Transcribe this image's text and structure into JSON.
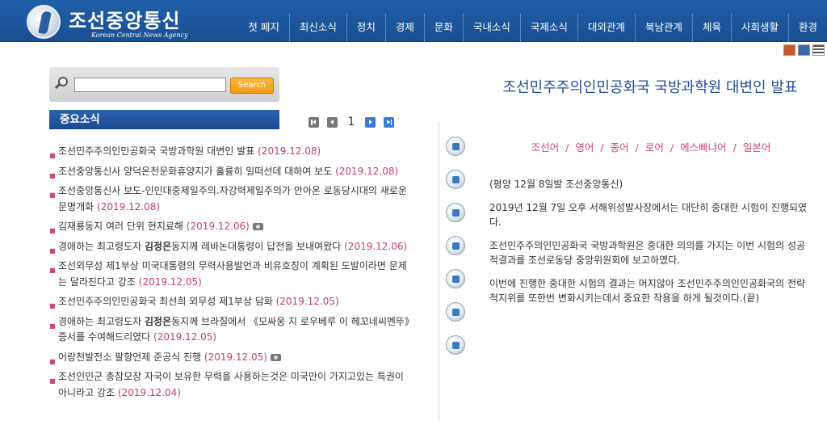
{
  "header": {
    "logo_title": "조선중앙통신",
    "logo_subtitle": "Korean Central News Agency",
    "nav": [
      "첫 페지",
      "최신소식",
      "정치",
      "경제",
      "문화",
      "국내소식",
      "국제소식",
      "대외관계",
      "북남관계",
      "체육",
      "사회생활",
      "환경"
    ]
  },
  "search": {
    "value": "",
    "button_label": "Search"
  },
  "news": {
    "title": "중요소식",
    "current_page": "1",
    "items": [
      {
        "text": "조선민주주의인민공화국 국방과학원 대변인 발표",
        "date": "(2019.12.08)",
        "photo": false
      },
      {
        "text": "조선중앙통신사 양덕온천문화휴양지가 훌륭히 일떠선데 대하여 보도",
        "date": "(2019.12.08)",
        "photo": false
      },
      {
        "text": "조선중앙통신사 보도-인민대중제일주의.자강력제일주의가 안아온 로동당시대의 새로운 문명개화",
        "date": "(2019.12.08)",
        "photo": false
      },
      {
        "text": "김재룡동지 여러 단위 현지료해",
        "date": "(2019.12.06)",
        "photo": true
      },
      {
        "text_pre": "경애하는 최고령도자 ",
        "text_bold": "김정은",
        "text_post": "동지께 레바논대통령이 답전을 보내여왔다",
        "date": "(2019.12.06)",
        "photo": false
      },
      {
        "text": "조선외무성 제1부상 미국대통령의 무력사용발언과 비유호칭이 계획된 도발이라면 문제는 달라진다고 강조",
        "date": "(2019.12.05)",
        "photo": false
      },
      {
        "text": "조선민주주의인민공화국 최선희 외무성 제1부상 담화",
        "date": "(2019.12.05)",
        "photo": false
      },
      {
        "text_pre": "경애하는 최고령도자 ",
        "text_bold": "김정은",
        "text_post": "동지께 브라질에서 《모싸웅 지 로우베루 이 헤꼬네씨멘뚜》증서를 수여해드리였다",
        "date": "(2019.12.05)",
        "photo": false
      },
      {
        "text": "어랑천발전소 팔향언제 준공식 진행",
        "date": "(2019.12.05)",
        "photo": true
      },
      {
        "text": "조선인민군 총참모장 자국이 보유한 무력을 사용하는것은 미국만이 가지고있는 특권이 아니라고 강조",
        "date": "(2019.12.04)",
        "photo": false
      }
    ]
  },
  "article": {
    "title": "조선민주주의인민공화국 국방과학원 대변인 발표",
    "languages": [
      "조선어",
      "영어",
      "중어",
      "로어",
      "에스빠냐어",
      "일본어"
    ],
    "separator": "/",
    "paragraphs": [
      "(평양 12월 8일발 조선중앙통신)",
      "2019년 12월 7일 오후 서해위성발사장에서는 대단히 중대한 시험이 진행되였다.",
      "조선민주주의인민공화국 국방과학원은 중대한 의의를 가지는 이번 시험의 성공적결과를 조선로동당 중앙위원회에 보고하였다.",
      "이번에 진행한 중대한 시험의 결과는 머지않아 조선민주주의인민공화국의 전략적지위를 또한번 변화시키는데서 중요한 작용을 하게 될것이다.(끝)"
    ]
  },
  "colors": {
    "header_blue": "#1f5fa8",
    "title_blue": "#1f4e96",
    "accent_pink": "#d2457e",
    "search_orange": "#f39a12"
  },
  "icons": {
    "utility": [
      "photo-icon",
      "video-icon",
      "menu-icon"
    ],
    "sidebar": [
      "photo-gallery-icon",
      "video-gallery-icon",
      "camera-icon",
      "audio-icon",
      "hotline-icon",
      "person-icon",
      "speaker-icon"
    ]
  }
}
